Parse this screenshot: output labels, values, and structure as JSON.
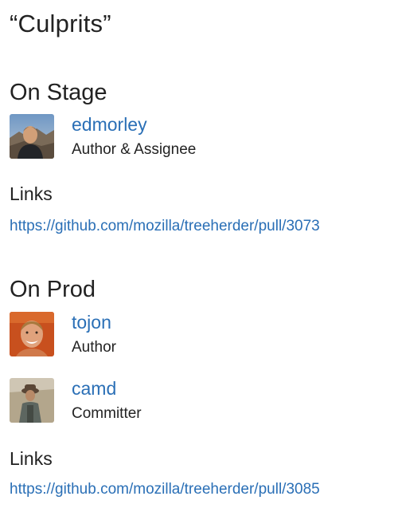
{
  "title": "“Culprits”",
  "sections": [
    {
      "heading": "On Stage",
      "people": [
        {
          "name": "edmorley",
          "role": "Author & Assignee",
          "avatar": "user-avatar-photo"
        }
      ],
      "links_heading": "Links",
      "links": [
        "https://github.com/mozilla/treeherder/pull/3073"
      ]
    },
    {
      "heading": "On Prod",
      "people": [
        {
          "name": "tojon",
          "role": "Author",
          "avatar": "user-avatar-photo"
        },
        {
          "name": "camd",
          "role": "Committer",
          "avatar": "user-avatar-photo"
        }
      ],
      "links_heading": "Links",
      "links": [
        "https://github.com/mozilla/treeherder/pull/3085"
      ]
    }
  ],
  "colors": {
    "link": "#2a6fb6",
    "text": "#222222",
    "background": "#ffffff"
  }
}
